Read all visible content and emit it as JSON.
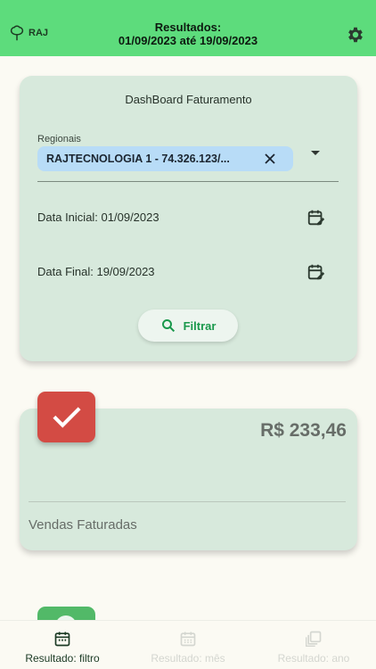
{
  "header": {
    "logo_text": "RAJ",
    "title_line1": "Resultados:",
    "title_line2": "01/09/2023 até 19/09/2023"
  },
  "filter": {
    "title": "DashBoard Faturamento",
    "regional_label": "Regionais",
    "regional_chip": "RAJTECNOLOGIA 1 - 74.326.123/...",
    "start_date": "Data Inicial: 01/09/2023",
    "end_date": "Data Final: 19/09/2023",
    "button_label": "Filtrar"
  },
  "result": {
    "amount": "R$ 233,46",
    "label": "Vendas Faturadas"
  },
  "nav": {
    "items": [
      {
        "label": "Resultado: filtro",
        "icon": "calendar-icon",
        "active": true
      },
      {
        "label": "Resultado: mês",
        "icon": "calendar-month-icon",
        "active": false
      },
      {
        "label": "Resultado: ano",
        "icon": "library-icon",
        "active": false
      }
    ]
  },
  "colors": {
    "appbar": "#5ddc7c",
    "card": "#d7e9dc",
    "accent_green": "#19984b",
    "status_red": "#d34b44",
    "chip": "#b8dcf7"
  }
}
